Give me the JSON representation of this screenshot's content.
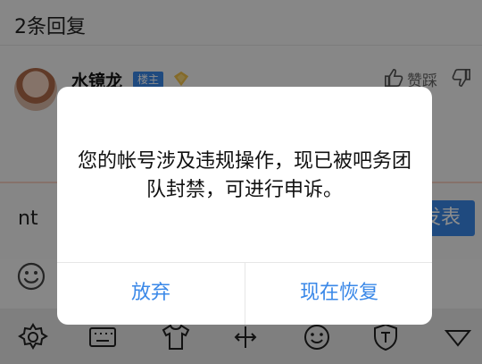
{
  "header": {
    "reply_count": "2条回复"
  },
  "reply": {
    "username": "水镜龙",
    "badge": "楼主",
    "like_label": "赞踩"
  },
  "composer": {
    "input_value": "nt",
    "publish_label": "发表"
  },
  "dialog": {
    "message": "您的帐号涉及违规操作，现已被吧务团队封禁，可进行申诉。",
    "cancel_label": "放弃",
    "confirm_label": "现在恢复"
  },
  "colors": {
    "accent": "#3a88e8",
    "overlay": "rgba(0,0,0,0.45)"
  },
  "keyboard_icons": [
    "gear-icon",
    "keyboard-icon",
    "shirt-icon",
    "cursor-icon",
    "smiley-icon",
    "shield-icon",
    "chevron-down-icon"
  ]
}
